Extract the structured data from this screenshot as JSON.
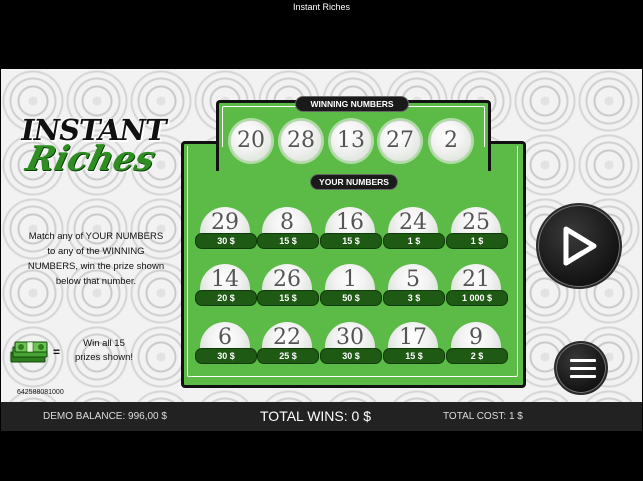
{
  "app": {
    "title": "Instant Riches"
  },
  "logo": {
    "line1": "INSTANT",
    "line2": "Riches"
  },
  "rules": {
    "lines": [
      "Match any of YOUR NUMBERS",
      "to any of the WINNING",
      "NUMBERS, win the prize shown",
      "below that number."
    ],
    "cash_equals": "=",
    "cash_lines": [
      "Win all 15",
      "prizes shown!"
    ]
  },
  "ticket_id": "642588081000",
  "board": {
    "winning_label": "WINNING NUMBERS",
    "your_label": "YOUR NUMBERS",
    "winning_numbers": [
      "20",
      "28",
      "13",
      "27",
      "2"
    ],
    "your_numbers": [
      {
        "number": "29",
        "prize": "30 $"
      },
      {
        "number": "8",
        "prize": "15 $"
      },
      {
        "number": "16",
        "prize": "15 $"
      },
      {
        "number": "24",
        "prize": "1 $"
      },
      {
        "number": "25",
        "prize": "1 $"
      },
      {
        "number": "14",
        "prize": "20 $"
      },
      {
        "number": "26",
        "prize": "15 $"
      },
      {
        "number": "1",
        "prize": "50 $"
      },
      {
        "number": "5",
        "prize": "3 $"
      },
      {
        "number": "21",
        "prize": "1 000 $"
      },
      {
        "number": "6",
        "prize": "30 $"
      },
      {
        "number": "22",
        "prize": "25 $"
      },
      {
        "number": "30",
        "prize": "30 $"
      },
      {
        "number": "17",
        "prize": "15 $"
      },
      {
        "number": "9",
        "prize": "2 $"
      }
    ]
  },
  "controls": {
    "play_icon": "play-icon",
    "menu_icon": "hamburger-menu-icon"
  },
  "footer": {
    "balance": "DEMO BALANCE: 996,00 $",
    "total_wins": "TOTAL WINS: 0 $",
    "total_cost": "TOTAL COST: 1 $"
  },
  "colors": {
    "board_green": "#5cba47",
    "prize_green": "#1f5a15",
    "logo_green": "#2f8e22"
  }
}
